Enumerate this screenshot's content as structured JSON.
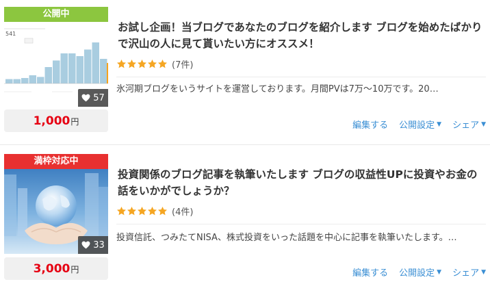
{
  "listings": [
    {
      "badge": "公開中",
      "likes": "57",
      "price": "1,000",
      "yen": "円",
      "title": "お試し企画！当ブログであなたのブログを紹介します ブログを始めたばかりで沢山の人に見て貰いたい方にオススメ！",
      "rating": 5,
      "reviews": "(7件)",
      "description": "氷河期ブログをいうサイトを運営しております。月間PVは7万～10万です。20…",
      "thumb_text": "541",
      "chart_values": [
        0.08,
        0.08,
        0.1,
        0.15,
        0.12,
        0.3,
        0.42,
        0.55,
        0.55,
        0.5,
        0.62,
        0.75,
        0.45
      ]
    },
    {
      "badge": "満枠対応中",
      "likes": "33",
      "price": "3,000",
      "yen": "円",
      "title": "投資関係のブログ記事を執筆いたします ブログの収益性UPに投資やお金の話をいかがでしょうか？",
      "rating": 5,
      "reviews": "(4件)",
      "description": "投資信託、つみたてNISA、株式投資をいった話題を中心に記事を執筆いたします。…"
    }
  ],
  "actions": {
    "edit": "編集する",
    "publish": "公開設定",
    "share": "シェア"
  },
  "colors": {
    "badge_public": "#8cc63f",
    "badge_full": "#e83030",
    "price": "#e60012",
    "link": "#3b8fd4",
    "star": "#f5a623"
  }
}
